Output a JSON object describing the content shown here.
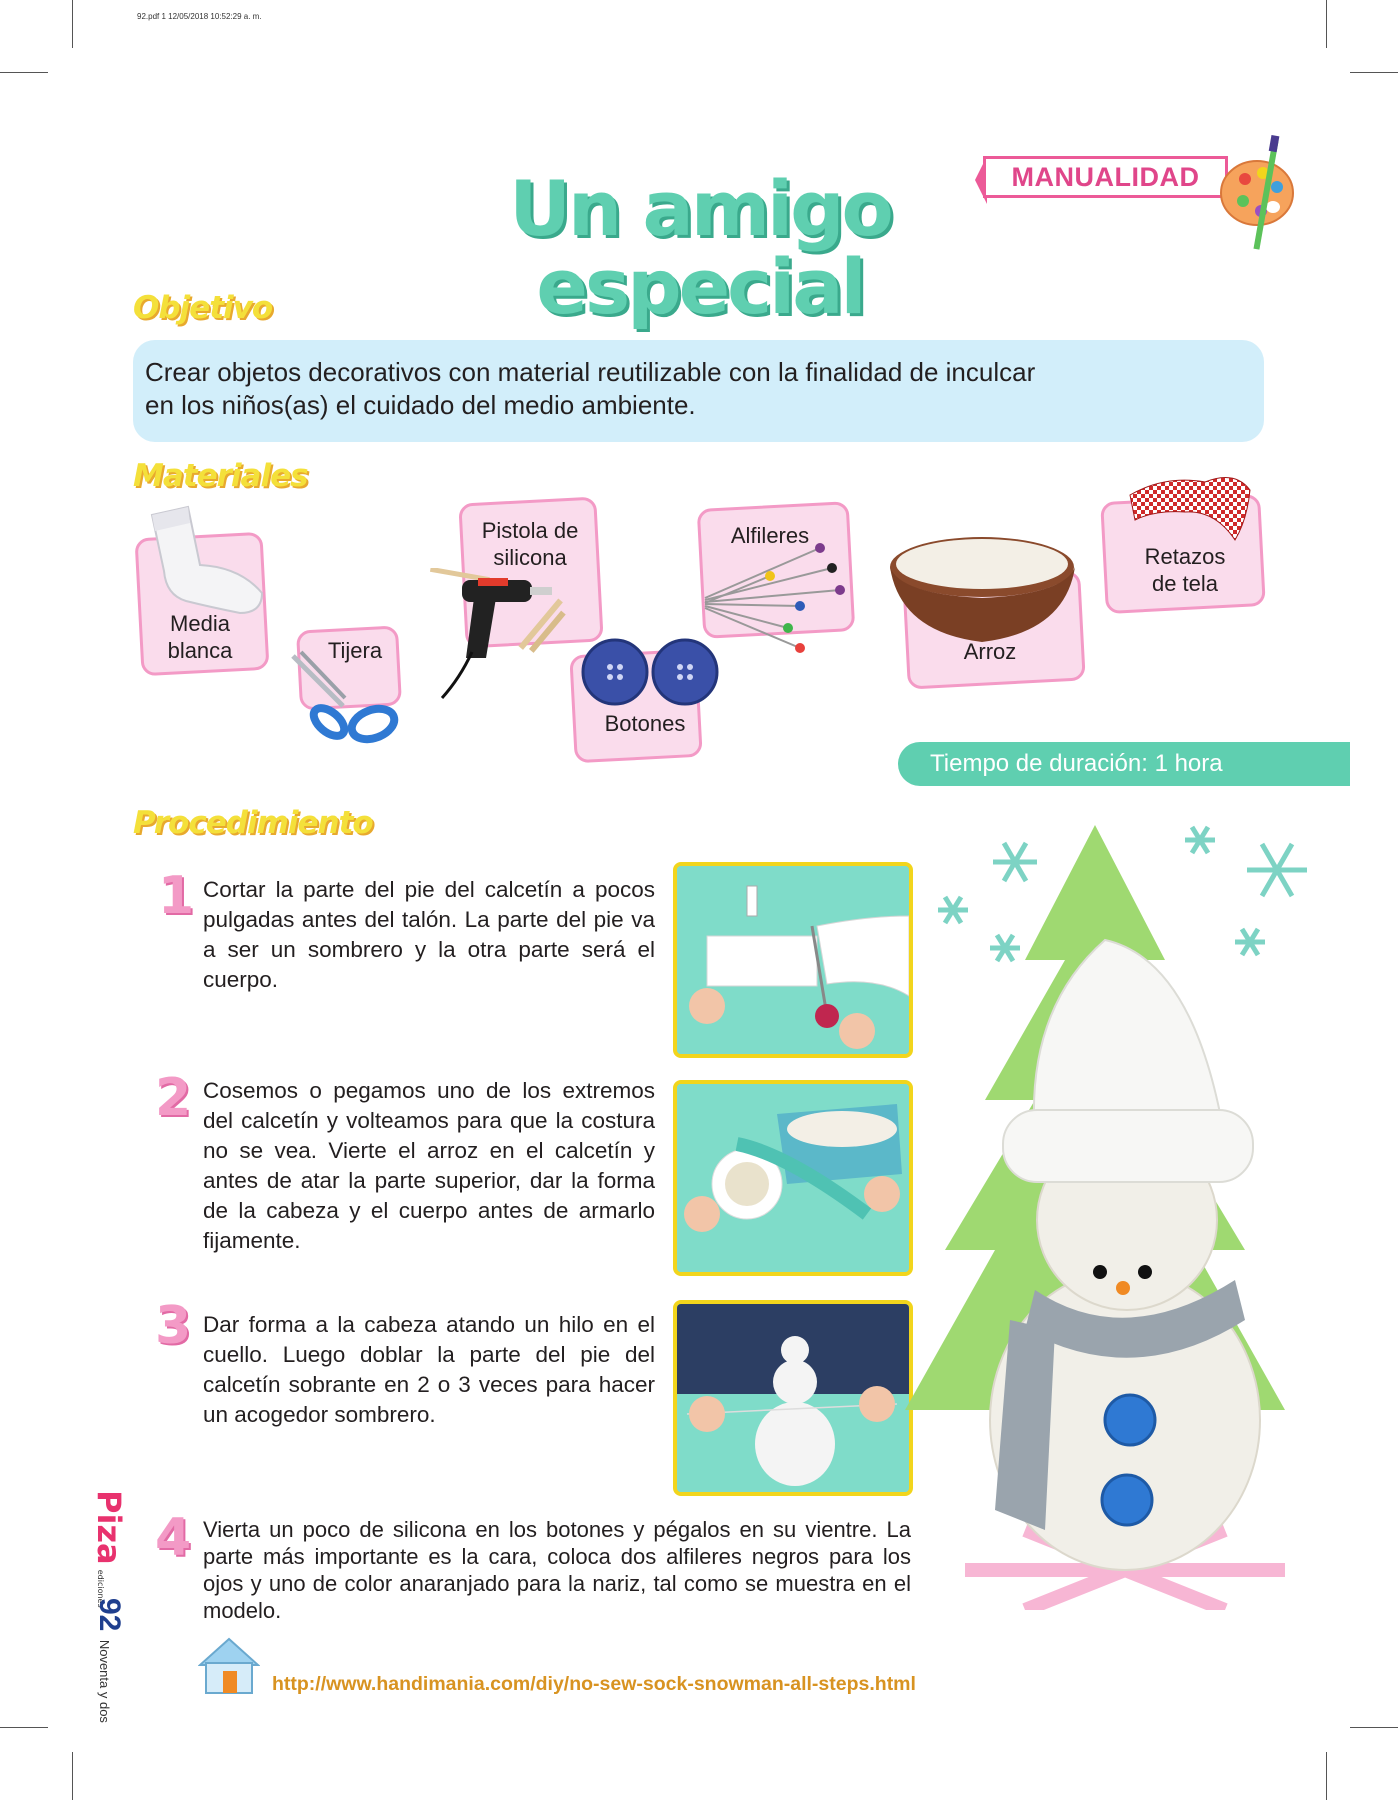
{
  "print_header": "92.pdf   1   12/05/2018   10:52:29 a. m.",
  "title": {
    "line1": "Un amigo",
    "line2": "especial"
  },
  "tag": {
    "label": "MANUALIDAD",
    "icon": "palette-icon"
  },
  "objective": {
    "heading": "Objetivo",
    "text_line1": "Crear objetos decorativos con material reutilizable con la finalidad de inculcar",
    "text_line2": "en los niños(as) el cuidado del medio ambiente."
  },
  "materials": {
    "heading": "Materiales",
    "items": [
      {
        "line1": "Media",
        "line2": "blanca",
        "icon": "sock-icon"
      },
      {
        "line1": "Tijera",
        "line2": "",
        "icon": "scissors-icon"
      },
      {
        "line1": "Pistola de",
        "line2": "silicona",
        "icon": "glue-gun-icon"
      },
      {
        "line1": "Botones",
        "line2": "",
        "icon": "buttons-icon"
      },
      {
        "line1": "Alfileres",
        "line2": "",
        "icon": "pins-icon"
      },
      {
        "line1": "Arroz",
        "line2": "",
        "icon": "rice-bowl-icon"
      },
      {
        "line1": "Retazos",
        "line2": "de tela",
        "icon": "fabric-icon"
      }
    ]
  },
  "duration": "Tiempo de duración: 1 hora",
  "procedure": {
    "heading": "Procedimiento",
    "steps": [
      {
        "num": "1",
        "text": "Cortar la parte del pie del calcetín a pocos pulgadas antes del talón. La parte del pie va a ser un sombrero y la otra parte será el cuerpo."
      },
      {
        "num": "2",
        "text": "Cosemos o pegamos uno de los extremos del calcetín y volteamos para que la costura no se vea. Vierte el arroz en el calcetín y antes de atar la parte superior, dar la forma de la cabeza y el cuerpo antes de armarlo fijamente."
      },
      {
        "num": "3",
        "text": "Dar forma a la cabeza atando un hilo en el cuello. Luego doblar la parte del pie del calcetín sobrante en 2 o 3 veces para hacer un acogedor sombrero."
      },
      {
        "num": "4",
        "text": "Vierta un poco de silicona en los botones y pégalos en su vientre. La parte más importante es la cara, coloca dos alfileres negros para los ojos y uno de color anaranjado para la nariz, tal como se muestra en el modelo."
      }
    ]
  },
  "url": "http://www.handimania.com/diy/no-sew-sock-snowman-all-steps.html",
  "footer": {
    "brand": "Piza",
    "brand_sub": "ediciones",
    "page_number": "92",
    "page_words": "Noventa y dos"
  },
  "colors": {
    "accent_teal": "#5fcfb0",
    "pink": "#f39ac6",
    "yellow": "#f4e03a",
    "light_blue": "#d2eefa"
  }
}
